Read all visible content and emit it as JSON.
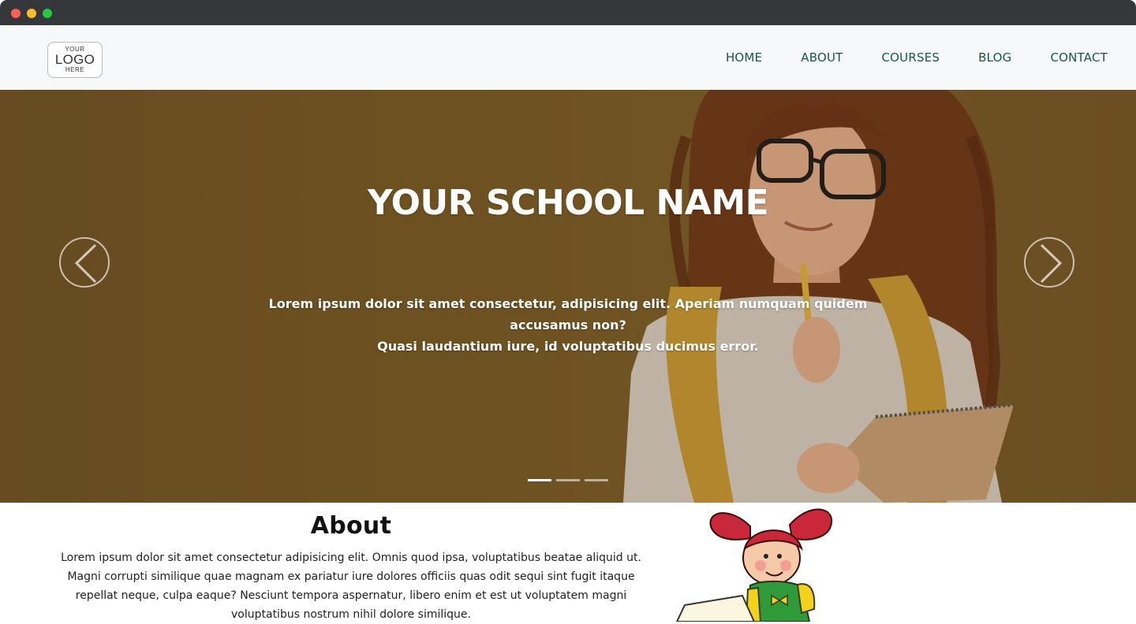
{
  "window": {
    "controls": [
      "close",
      "minimize",
      "maximize"
    ]
  },
  "logo": {
    "line1": "YOUR",
    "line2": "LOGO",
    "line3": "HERE"
  },
  "nav": {
    "items": [
      {
        "label": "HOME"
      },
      {
        "label": "ABOUT"
      },
      {
        "label": "COURSES"
      },
      {
        "label": "BLOG"
      },
      {
        "label": "CONTACT"
      }
    ]
  },
  "hero": {
    "title": "YOUR SCHOOL NAME",
    "text_line1": "Lorem ipsum dolor sit amet consectetur, adipisicing elit. Aperiam numquam quidem accusamus non?",
    "text_line2": "Quasi laudantium iure, id voluptatibus ducimus error.",
    "slides": 3,
    "active_slide": 1,
    "prev_icon": "chevron-left-icon",
    "next_icon": "chevron-right-icon"
  },
  "about": {
    "title": "About",
    "text": "Lorem ipsum dolor sit amet consectetur adipisicing elit. Omnis quod ipsa, voluptatibus beatae aliquid ut. Magni corrupti similique quae magnam ex pariatur iure dolores officiis quas odit sequi sint fugit itaque repellat neque, culpa eaque? Nesciunt tempora aspernatur, libero enim et est ut voluptatem magni voluptatibus nostrum nihil dolore similique."
  },
  "colors": {
    "nav_text": "#155a45",
    "hero_tint": "#775a27",
    "titlebar": "#36373a"
  }
}
